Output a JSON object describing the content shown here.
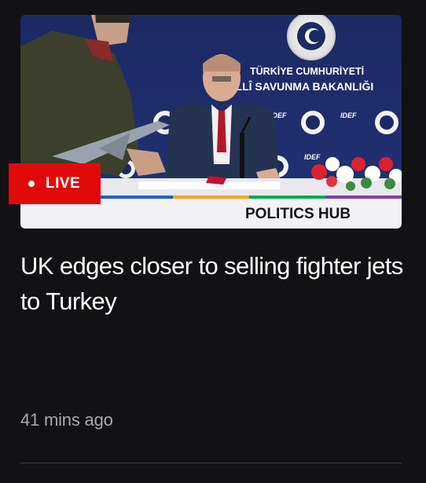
{
  "article": {
    "image": {
      "ministry_line1": "TÜRKİYE CUMHURİYETİ",
      "ministry_line2": "MİLLÎ SAVUNMA BAKANLIĞI",
      "banner_left": "IDEF",
      "hub_label": "POLITICS HUB"
    },
    "live_label": "LIVE",
    "headline": "UK edges closer to selling fighter jets to Turkey",
    "timestamp": "41 mins ago"
  },
  "colors": {
    "background": "#121214",
    "live_red": "#e10a0a",
    "timestamp_grey": "#a9a9ad",
    "backdrop_blue": "#1d2a5a"
  }
}
